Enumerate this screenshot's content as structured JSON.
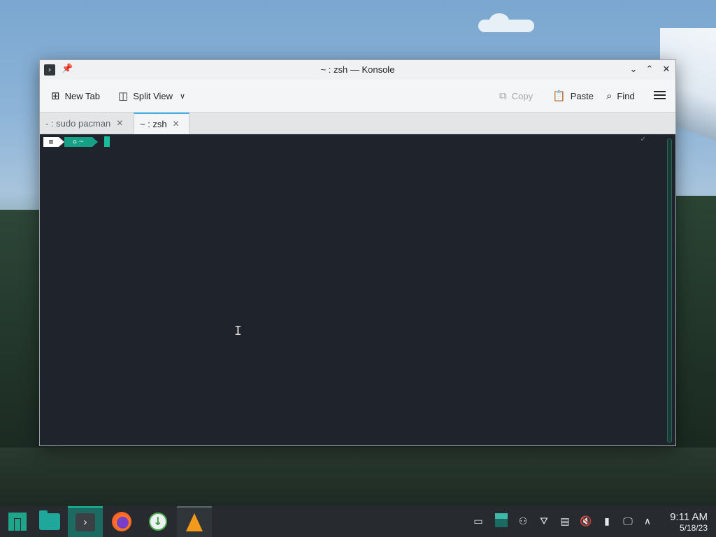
{
  "window": {
    "title": "~ : zsh — Konsole",
    "toolbar": {
      "new_tab": "New Tab",
      "split_view": "Split View",
      "copy": "Copy",
      "paste": "Paste",
      "find": "Find"
    },
    "tabs": [
      {
        "label": "- : sudo pacman",
        "active": false
      },
      {
        "label": "~ : zsh",
        "active": true
      }
    ],
    "terminal": {
      "prompt_home_glyph": "⌂ ~",
      "background": "#1f232b",
      "cursor_color": "#1abc9c"
    }
  },
  "taskbar": {
    "apps": [
      {
        "name": "application-launcher"
      },
      {
        "name": "file-manager"
      },
      {
        "name": "konsole",
        "active": true
      },
      {
        "name": "firefox"
      },
      {
        "name": "download-manager"
      },
      {
        "name": "vlc"
      }
    ],
    "tray_icons": [
      "show-desktop",
      "pager",
      "network",
      "vlc",
      "clipboard",
      "volume-muted",
      "usb",
      "display",
      "expand"
    ],
    "clock": {
      "time": "9:11 AM",
      "date": "5/18/23"
    },
    "accent": "#1abc9c"
  }
}
